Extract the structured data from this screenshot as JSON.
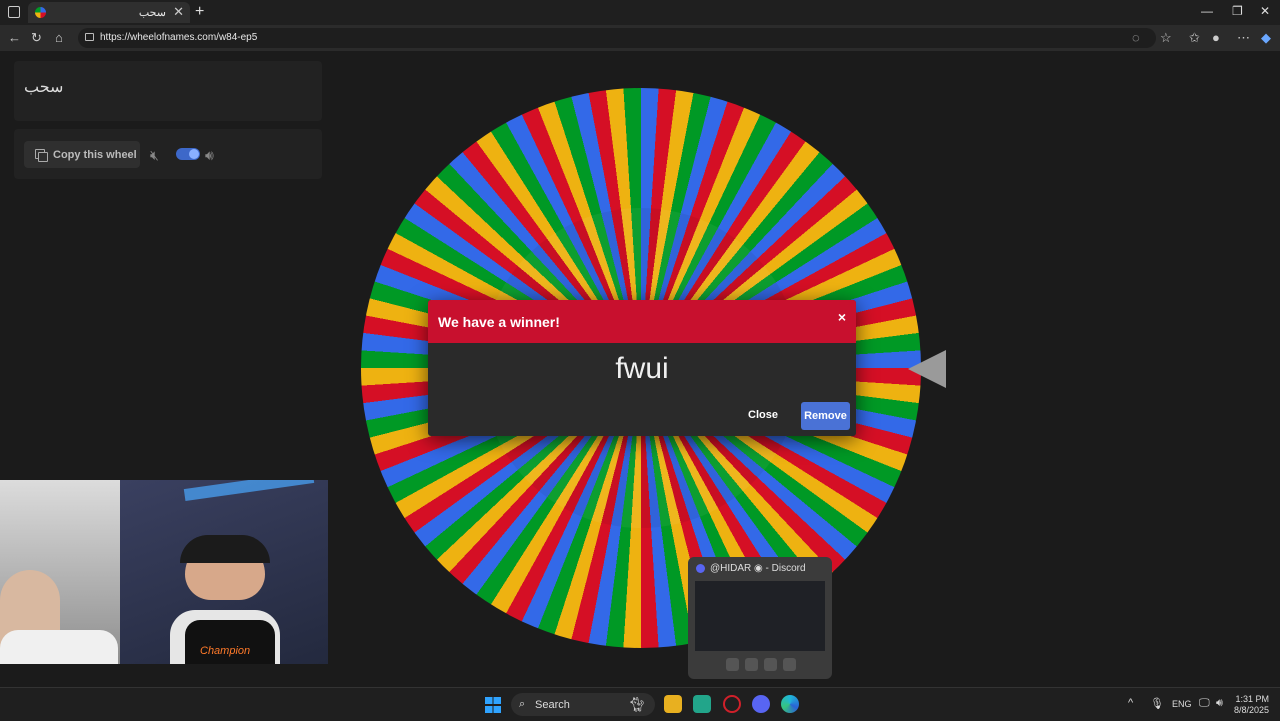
{
  "browser": {
    "tab_title": "سحب",
    "tab_close": "✕",
    "new_tab": "+",
    "url": "https://wheelofnames.com/w84-ep5",
    "window_controls": [
      "—",
      "❐",
      "✕"
    ]
  },
  "sidebar": {
    "wheel_title": "سحب",
    "copy_button": "Copy this wheel",
    "sound_toggle_on": true
  },
  "dialog": {
    "title": "We have a winner!",
    "close_x": "×",
    "winner": "fwui",
    "close_button": "Close",
    "remove_button": "Remove"
  },
  "wheel": {
    "colors": [
      "#3369e8",
      "#d50f25",
      "#eeb211",
      "#009925"
    ]
  },
  "discord_preview": {
    "title": "@HIDAR ◉ - Discord"
  },
  "webcam": {
    "shirt_text": "Champion"
  },
  "taskbar": {
    "search": "Search",
    "language": "ENG",
    "time": "1:31 PM",
    "date": "8/8/2025"
  }
}
